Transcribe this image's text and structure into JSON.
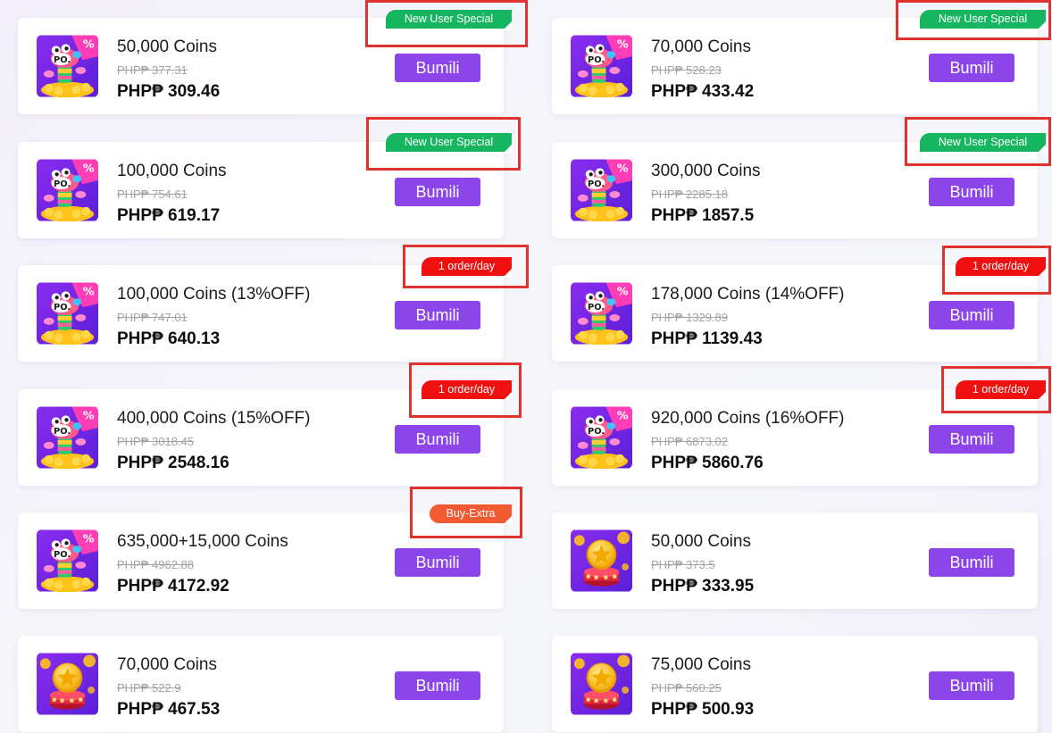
{
  "currency_note": "PHP₱",
  "buy_label": "Bumili",
  "tags": {
    "new_user": "New User Special",
    "one_per_day": "1 order/day",
    "buy_extra": "Buy-Extra"
  },
  "colors": {
    "buy_button": "#8c45e8",
    "tag_green": "#16b560",
    "tag_red": "#f01010",
    "tag_orange": "#f25a32",
    "highlight_box": "#e0322f"
  },
  "products": [
    {
      "title": "50,000 Coins",
      "original": "PHP₱ 377.31",
      "price": "PHP₱ 309.46",
      "image": "bean-mascot-icon"
    },
    {
      "title": "70,000 Coins",
      "original": "PHP₱ 528.23",
      "price": "PHP₱ 433.42",
      "image": "bean-mascot-icon"
    },
    {
      "title": "100,000 Coins",
      "original": "PHP₱ 754.61",
      "price": "PHP₱ 619.17",
      "image": "bean-mascot-icon"
    },
    {
      "title": "300,000 Coins",
      "original": "PHP₱ 2285.18",
      "price": "PHP₱ 1857.5",
      "image": "bean-mascot-icon"
    },
    {
      "title": "100,000 Coins (13%OFF)",
      "original": "PHP₱ 747.01",
      "price": "PHP₱ 640.13",
      "image": "bean-mascot-icon"
    },
    {
      "title": "178,000 Coins (14%OFF)",
      "original": "PHP₱ 1329.89",
      "price": "PHP₱ 1139.43",
      "image": "bean-mascot-icon"
    },
    {
      "title": "400,000 Coins (15%OFF)",
      "original": "PHP₱ 3018.45",
      "price": "PHP₱ 2548.16",
      "image": "bean-mascot-icon"
    },
    {
      "title": "920,000 Coins (16%OFF)",
      "original": "PHP₱ 6873.02",
      "price": "PHP₱ 5860.76",
      "image": "bean-mascot-icon"
    },
    {
      "title": "635,000+15,000 Coins",
      "original": "PHP₱ 4962.88",
      "price": "PHP₱ 4172.92",
      "image": "bean-mascot-icon"
    },
    {
      "title": "50,000 Coins",
      "original": "PHP₱ 373.5",
      "price": "PHP₱ 333.95",
      "image": "coin-stack-icon"
    },
    {
      "title": "70,000 Coins",
      "original": "PHP₱ 522.9",
      "price": "PHP₱ 467.53",
      "image": "coin-stack-icon"
    },
    {
      "title": "75,000 Coins",
      "original": "PHP₱ 560.25",
      "price": "PHP₱ 500.93",
      "image": "coin-stack-icon"
    }
  ]
}
